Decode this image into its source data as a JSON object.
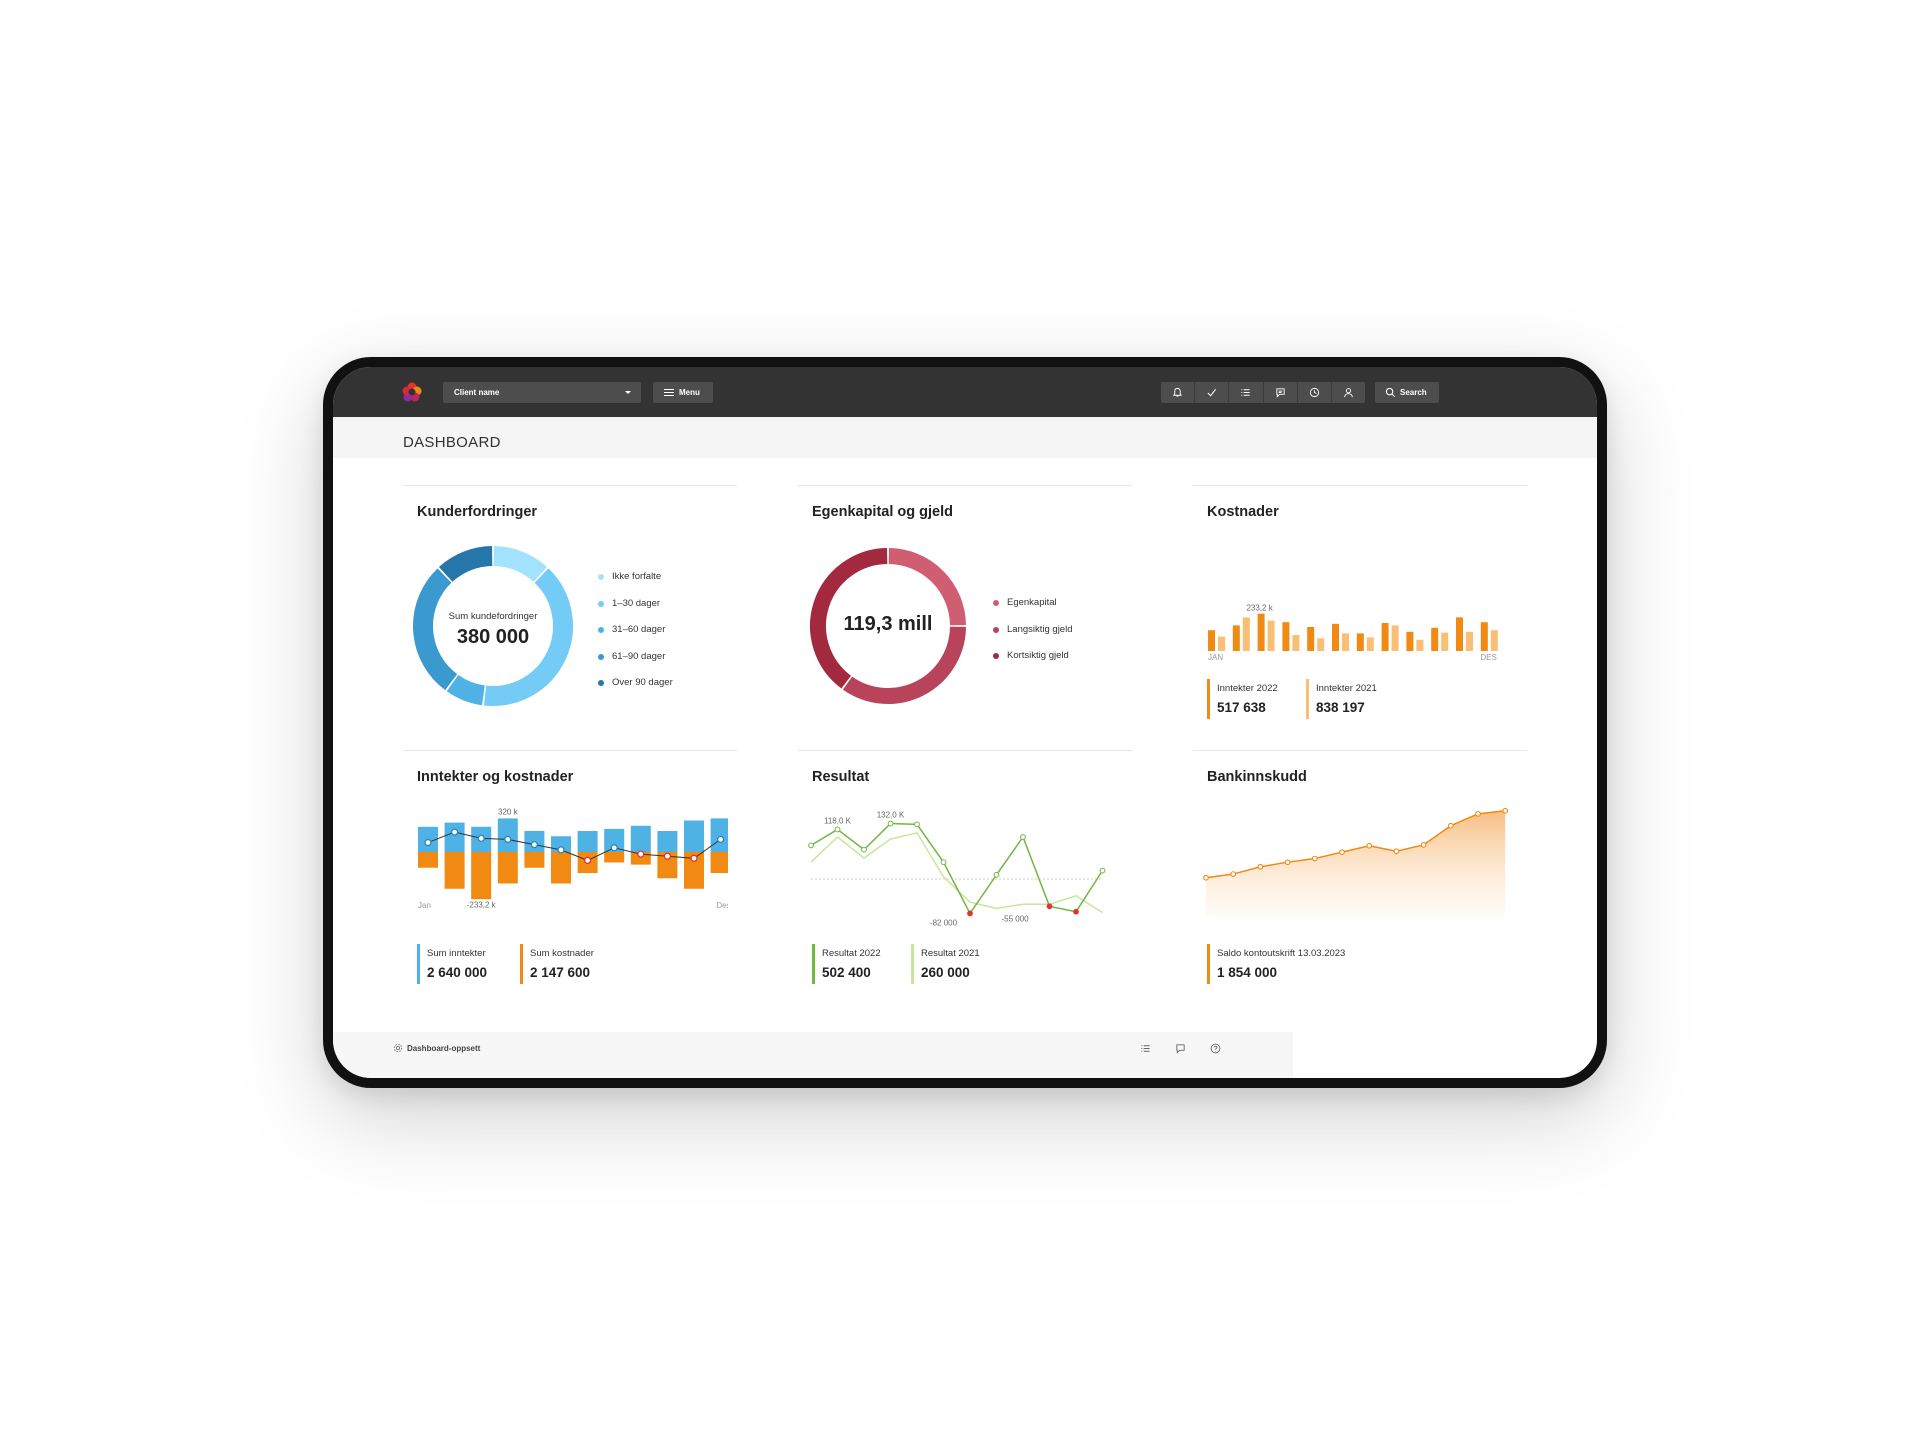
{
  "topbar": {
    "client_select": "Client name",
    "menu_label": "Menu",
    "icons": [
      "bell-icon",
      "check-icon",
      "list-icon",
      "chat-icon",
      "clock-icon",
      "user-icon"
    ],
    "search_label": "Search"
  },
  "page": {
    "title": "DASHBOARD"
  },
  "colors": {
    "topbar": "#333333",
    "blue_light": "#9fddfb",
    "blue": "#4fb2e4",
    "blue_dark": "#2a86b8",
    "orange": "#f08a12",
    "orange_light": "#f9bf74",
    "crimson": "#a3293f",
    "rose": "#cf5e72",
    "green": "#73b644",
    "green_light": "#c8e69b"
  },
  "cards": {
    "kunder": {
      "title": "Kunderfordringer",
      "center_label": "Sum kundefordringer",
      "center_value": "380 000",
      "legend": [
        {
          "label": "Ikke forfalte",
          "color": "#a3e2fc"
        },
        {
          "label": "1–30 dager",
          "color": "#74cbf5"
        },
        {
          "label": "31–60 dager",
          "color": "#4fb2e4"
        },
        {
          "label": "61–90 dager",
          "color": "#3a9ad0"
        },
        {
          "label": "Over 90 dager",
          "color": "#2477a8"
        }
      ]
    },
    "egenkapital": {
      "title": "Egenkapital og gjeld",
      "center_value": "119,3 mill",
      "legend": [
        {
          "label": "Egenkapital",
          "color": "#cf5e72"
        },
        {
          "label": "Langsiktig gjeld",
          "color": "#b8435a"
        },
        {
          "label": "Kortsiktig gjeld",
          "color": "#a3293f"
        }
      ]
    },
    "kostnader": {
      "title": "Kostnader",
      "stats": [
        {
          "label": "Inntekter 2022",
          "value": "517 638"
        },
        {
          "label": "Inntekter 2021",
          "value": "838 197"
        }
      ]
    },
    "inntekter": {
      "title": "Inntekter og kostnader",
      "stats": [
        {
          "label": "Sum inntekter",
          "value": "2 640 000"
        },
        {
          "label": "Sum kostnader",
          "value": "2 147 600"
        }
      ]
    },
    "resultat": {
      "title": "Resultat",
      "stats": [
        {
          "label": "Resultat 2022",
          "value": "502 400"
        },
        {
          "label": "Resultat 2021",
          "value": "260 000"
        }
      ]
    },
    "bank": {
      "title": "Bankinnskudd",
      "stats": [
        {
          "label": "Saldo kontoutskrift 13.03.2023",
          "value": "1 854 000"
        }
      ]
    }
  },
  "footer": {
    "label": "Dashboard-oppsett",
    "icons": [
      "list-icon",
      "chat-icon",
      "help-icon"
    ]
  },
  "chart_data": [
    {
      "type": "pie",
      "labels": [
        "Ikke forfalte",
        "1–30 dager",
        "31–60 dager",
        "61–90 dager",
        "Over 90 dager"
      ],
      "values": [
        12,
        40,
        8,
        28,
        12
      ],
      "colors": [
        "#a3e2fc",
        "#74cbf5",
        "#4fb2e4",
        "#3a9ad0",
        "#2477a8"
      ]
    },
    {
      "type": "pie",
      "labels": [
        "Egenkapital",
        "Langsiktig gjeld",
        "Kortsiktig gjeld"
      ],
      "values": [
        25,
        35,
        40
      ],
      "colors": [
        "#cf5e72",
        "#b8435a",
        "#a3293f"
      ]
    },
    {
      "type": "bar",
      "categories": [
        "JAN",
        "",
        "",
        "",
        "",
        "",
        "",
        "",
        "",
        "",
        "",
        "DES"
      ],
      "series": [
        {
          "values": [
            130,
            160,
            233.2,
            180,
            150,
            170,
            110,
            175,
            120,
            145,
            210,
            180
          ]
        },
        {
          "values": [
            90,
            210,
            190,
            100,
            80,
            110,
            85,
            160,
            70,
            115,
            120,
            130
          ]
        }
      ],
      "annotations": [
        {
          "text": "233,2 k"
        }
      ],
      "tick_labels": [
        "JAN",
        "DES"
      ],
      "ylim": [
        0,
        250
      ]
    },
    {
      "type": "bar",
      "categories": [
        "Jan",
        "",
        "",
        "",
        "",
        "",
        "",
        "",
        "",
        "",
        "",
        "Des"
      ],
      "series": [
        {
          "values": [
            240,
            280,
            240,
            320,
            200,
            150,
            200,
            220,
            250,
            200,
            300,
            320
          ]
        },
        {
          "values": [
            -150,
            -350,
            -450,
            -300,
            -150,
            -300,
            -200,
            -100,
            -120,
            -250,
            -350,
            -200
          ]
        },
        {
          "values": [
            90,
            190,
            130,
            120,
            70,
            20,
            -80,
            40,
            -20,
            -40,
            -60,
            120
          ]
        }
      ],
      "annotations": [
        {
          "text": "320 k"
        },
        {
          "text": "-233,2 k"
        }
      ],
      "tick_labels": [
        "Jan",
        "Des"
      ],
      "ylim": [
        -480,
        340
      ]
    },
    {
      "type": "line",
      "x": [
        1,
        2,
        3,
        4,
        5,
        6,
        7,
        8,
        9,
        10,
        11,
        12
      ],
      "series": [
        {
          "values": [
            80,
            118,
            70,
            132,
            130,
            40,
            -82,
            10,
            100,
            -65,
            -78,
            20
          ]
        },
        {
          "values": [
            40,
            100,
            50,
            95,
            110,
            5,
            -55,
            -70,
            -60,
            -60,
            -40,
            -80
          ]
        }
      ],
      "annotations": [
        {
          "text": "118,0 K"
        },
        {
          "text": "132,0 K"
        },
        {
          "text": "-82 000"
        },
        {
          "text": "-55 000"
        }
      ],
      "ylim": [
        -110,
        150
      ]
    },
    {
      "type": "area",
      "x": [
        1,
        2,
        3,
        4,
        5,
        6,
        7,
        8,
        9,
        10,
        11,
        12
      ],
      "values": [
        1120,
        1160,
        1240,
        1290,
        1330,
        1400,
        1470,
        1410,
        1480,
        1690,
        1820,
        1854
      ],
      "ylim": [
        700,
        1950
      ]
    }
  ]
}
